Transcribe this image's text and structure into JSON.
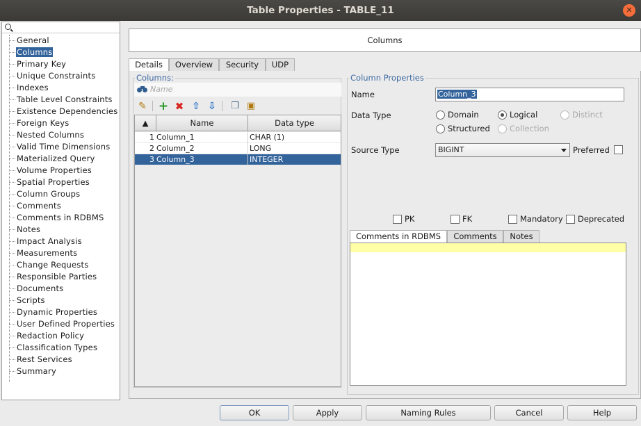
{
  "window": {
    "title": "Table Properties - TABLE_11",
    "close_glyph": "✕"
  },
  "nav": {
    "items": [
      "General",
      "Columns",
      "Primary Key",
      "Unique Constraints",
      "Indexes",
      "Table Level Constraints",
      "Existence Dependencies",
      "Foreign Keys",
      "Nested Columns",
      "Valid Time Dimensions",
      "Materialized Query",
      "Volume Properties",
      "Spatial Properties",
      "Column Groups",
      "Comments",
      "Comments in RDBMS",
      "Notes",
      "Impact Analysis",
      "Measurements",
      "Change Requests",
      "Responsible Parties",
      "Documents",
      "Scripts",
      "Dynamic Properties",
      "User Defined Properties",
      "Redaction Policy",
      "Classification Types",
      "Rest Services",
      "Summary"
    ],
    "selected": "Columns"
  },
  "header": {
    "title": "Columns"
  },
  "tabs": [
    "Details",
    "Overview",
    "Security",
    "UDP"
  ],
  "columns_group": {
    "label": "Columns:",
    "filter_placeholder": "Name",
    "table": {
      "headers": [
        "Name",
        "Data type"
      ],
      "rows": [
        {
          "num": "1",
          "name": "Column_1",
          "type": "CHAR (1)"
        },
        {
          "num": "2",
          "name": "Column_2",
          "type": "LONG"
        },
        {
          "num": "3",
          "name": "Column_3",
          "type": "INTEGER"
        }
      ],
      "selected_row": 3
    }
  },
  "props": {
    "label": "Column Properties",
    "name_label": "Name",
    "name_value": "Column_3",
    "datatype_label": "Data Type",
    "datatype_options": {
      "domain": "Domain",
      "logical": "Logical",
      "distinct": "Distinct",
      "structured": "Structured",
      "collection": "Collection"
    },
    "datatype_selected": "Logical",
    "source_type_label": "Source Type",
    "source_type_value": "BIGINT",
    "preferred_label": "Preferred",
    "checks": {
      "pk": "PK",
      "fk": "FK",
      "mandatory": "Mandatory",
      "deprecated": "Deprecated"
    }
  },
  "comment_tabs": [
    "Comments in RDBMS",
    "Comments",
    "Notes"
  ],
  "buttons": {
    "ok": "OK",
    "apply": "Apply",
    "naming_rules": "Naming Rules",
    "cancel": "Cancel",
    "help": "Help"
  },
  "colors": {
    "selection": "#33639b",
    "group_label": "#3e6aa3",
    "comment_highlight": "#ffffa8"
  }
}
